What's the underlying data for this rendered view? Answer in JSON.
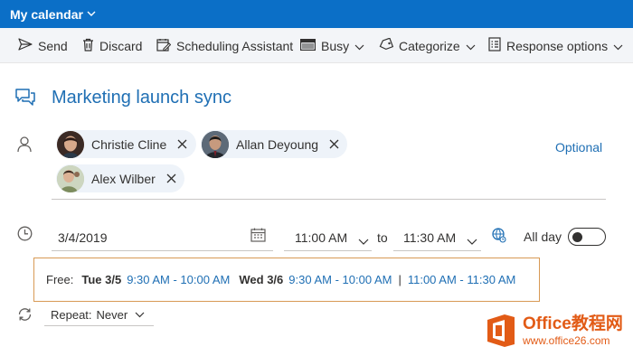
{
  "topbar": {
    "title": "My calendar"
  },
  "toolbar": {
    "send": "Send",
    "discard": "Discard",
    "scheduling_assistant": "Scheduling Assistant",
    "busy": "Busy",
    "categorize": "Categorize",
    "response_options": "Response options"
  },
  "event": {
    "title": "Marketing launch sync"
  },
  "attendees": [
    {
      "name": "Christie Cline"
    },
    {
      "name": "Allan Deyoung"
    },
    {
      "name": "Alex Wilber"
    }
  ],
  "optional_label": "Optional",
  "schedule": {
    "date": "3/4/2019",
    "start_time": "11:00 AM",
    "to_label": "to",
    "end_time": "11:30 AM",
    "all_day_label": "All day",
    "all_day_on": false
  },
  "free_times": {
    "label": "Free:",
    "days": [
      {
        "day": "Tue 3/5",
        "slots": [
          "9:30 AM - 10:00 AM"
        ]
      },
      {
        "day": "Wed 3/6",
        "slots": [
          "9:30 AM - 10:00 AM",
          "11:00 AM - 11:30 AM"
        ]
      }
    ],
    "separator": "|"
  },
  "repeat": {
    "label": "Repeat:",
    "value": "Never"
  },
  "watermark": {
    "brand": "Office教程网",
    "url": "www.office26.com"
  },
  "colors": {
    "topbar": "#0b6fc7",
    "accent": "#1f6fb4",
    "free_box_border": "#d89a55",
    "watermark": "#e25b16"
  }
}
